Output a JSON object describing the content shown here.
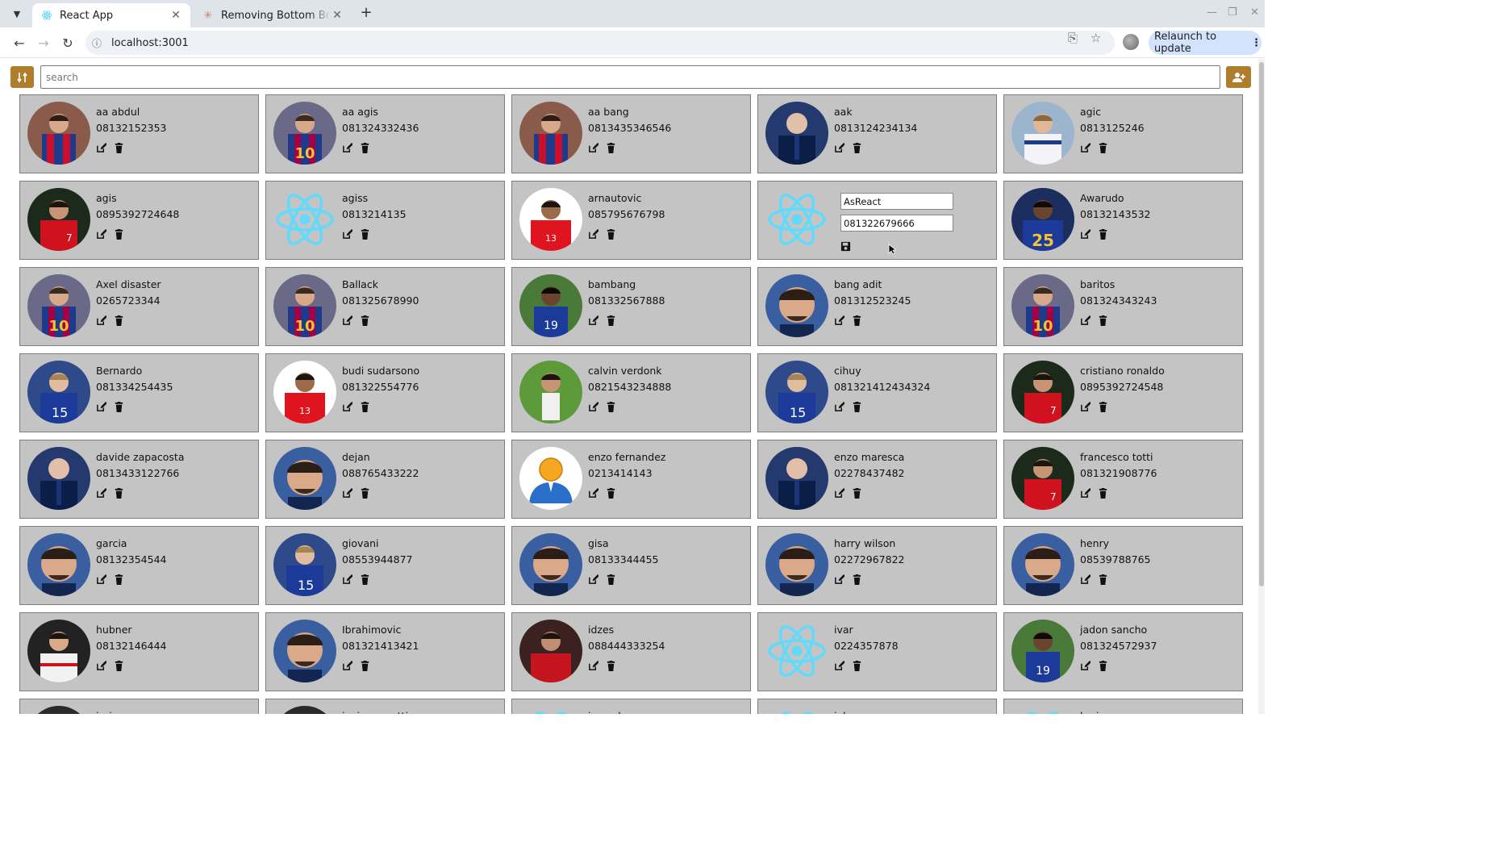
{
  "browser": {
    "tabs": [
      {
        "title": "React App",
        "active": true
      },
      {
        "title": "Removing Bottom Border",
        "active": false
      }
    ],
    "url": "localhost:3001",
    "relaunch_label": "Relaunch to update"
  },
  "app": {
    "search_placeholder": "search",
    "accent_color": "#b07d2c",
    "card_color": "#c4c4c4",
    "editing": {
      "name_value": "AsReact",
      "phone_value": "081322679666"
    },
    "contacts": [
      {
        "name": "aa abdul",
        "phone": "08132152353",
        "avatar": "barca-red"
      },
      {
        "name": "aa agis",
        "phone": "081324332436",
        "avatar": "barca-10"
      },
      {
        "name": "aa bang",
        "phone": "0813435346546",
        "avatar": "barca-red"
      },
      {
        "name": "aak",
        "phone": "0813124234134",
        "avatar": "coach"
      },
      {
        "name": "agic",
        "phone": "0813125246",
        "avatar": "white-kit"
      },
      {
        "name": "agis",
        "phone": "0895392724648",
        "avatar": "portugal"
      },
      {
        "name": "agiss",
        "phone": "0813214135",
        "avatar": "react"
      },
      {
        "name": "arnautovic",
        "phone": "085795676798",
        "avatar": "indo-13"
      },
      {
        "name": "",
        "phone": "",
        "avatar": "react",
        "editing": true
      },
      {
        "name": "Awarudo",
        "phone": "08132143532",
        "avatar": "blue-25"
      },
      {
        "name": "Axel disaster",
        "phone": "0265723344",
        "avatar": "barca-10"
      },
      {
        "name": "Ballack",
        "phone": "081325678990",
        "avatar": "barca-10"
      },
      {
        "name": "bambang",
        "phone": "081332567888",
        "avatar": "blue-19"
      },
      {
        "name": "bang adit",
        "phone": "081312523245",
        "avatar": "zlatan"
      },
      {
        "name": "baritos",
        "phone": "081324343243",
        "avatar": "barca-10"
      },
      {
        "name": "Bernardo",
        "phone": "081334254435",
        "avatar": "chelsea-15"
      },
      {
        "name": "budi sudarsono",
        "phone": "081322554776",
        "avatar": "indo-13"
      },
      {
        "name": "calvin verdonk",
        "phone": "0821543234888",
        "avatar": "white-pitch"
      },
      {
        "name": "cihuy",
        "phone": "081321412434324",
        "avatar": "chelsea-15"
      },
      {
        "name": "cristiano ronaldo",
        "phone": "0895392724548",
        "avatar": "portugal"
      },
      {
        "name": "davide zapacosta",
        "phone": "0813433122766",
        "avatar": "coach"
      },
      {
        "name": "dejan",
        "phone": "088765433222",
        "avatar": "zlatan"
      },
      {
        "name": "enzo fernandez",
        "phone": "0213414143",
        "avatar": "default-user"
      },
      {
        "name": "enzo maresca",
        "phone": "02278437482",
        "avatar": "coach"
      },
      {
        "name": "francesco totti",
        "phone": "081321908776",
        "avatar": "portugal"
      },
      {
        "name": "garcia",
        "phone": "08132354544",
        "avatar": "zlatan"
      },
      {
        "name": "giovani",
        "phone": "08553944877",
        "avatar": "chelsea-15"
      },
      {
        "name": "gisa",
        "phone": "08133344455",
        "avatar": "zlatan"
      },
      {
        "name": "harry wilson",
        "phone": "02272967822",
        "avatar": "zlatan"
      },
      {
        "name": "henry",
        "phone": "08539788765",
        "avatar": "zlatan"
      },
      {
        "name": "hubner",
        "phone": "08132146444",
        "avatar": "white-shirt"
      },
      {
        "name": "Ibrahimovic",
        "phone": "081321413421",
        "avatar": "zlatan"
      },
      {
        "name": "idzes",
        "phone": "088444333254",
        "avatar": "indo-red"
      },
      {
        "name": "ivar",
        "phone": "0224357878",
        "avatar": "react"
      },
      {
        "name": "jadon sancho",
        "phone": "081324572937",
        "avatar": "blue-19"
      },
      {
        "name": "jario",
        "phone": "",
        "avatar": "dark"
      },
      {
        "name": "javier zanetti",
        "phone": "",
        "avatar": "dark"
      },
      {
        "name": "joe cole",
        "phone": "",
        "avatar": "react"
      },
      {
        "name": "john",
        "phone": "",
        "avatar": "react"
      },
      {
        "name": "karisma",
        "phone": "",
        "avatar": "react"
      }
    ]
  }
}
